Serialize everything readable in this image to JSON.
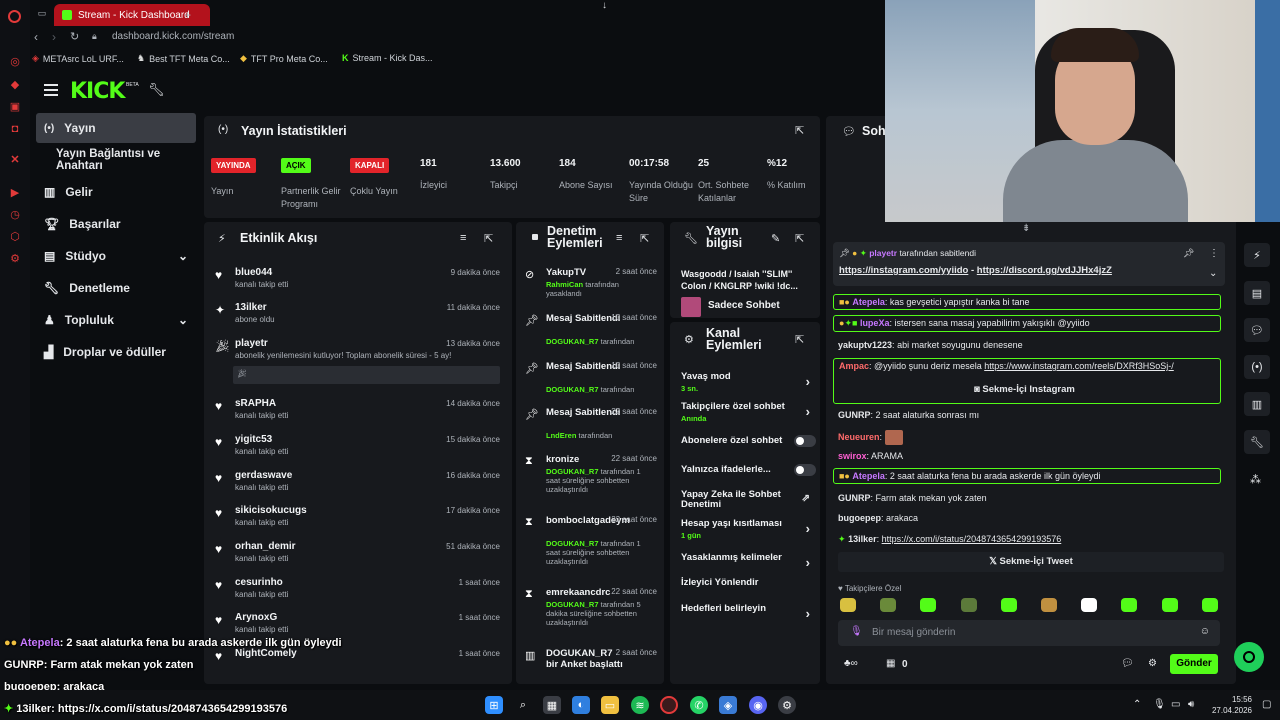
{
  "browser": {
    "tab_title": "Stream - Kick Dashboard",
    "address_domain": "dashboard.kick.com",
    "address_path": "/stream",
    "bookmarks": [
      "METAsrc LoL URF...",
      "Best TFT Meta Co...",
      "TFT Pro Meta Co...",
      "Stream - Kick Das..."
    ]
  },
  "kick": {
    "logo": "KICK",
    "beta": "BETA"
  },
  "sidebar": {
    "items": [
      "Yayın",
      "Yayın Bağlantısı ve Anahtarı",
      "Gelir",
      "Başarılar",
      "Stüdyo",
      "Denetleme",
      "Topluluk",
      "Droplar ve ödüller"
    ]
  },
  "stats": {
    "title": "Yayın İstatistikleri",
    "items": [
      {
        "value": "YAYINDA",
        "label": "Yayın",
        "color": "#e2242a"
      },
      {
        "value": "AÇIK",
        "label": "Partnerlik Gelir Programı",
        "color": "#53fc18"
      },
      {
        "value": "KAPALI",
        "label": "Çoklu Yayın",
        "color": "#e2242a"
      },
      {
        "value": "181",
        "label": "İzleyici"
      },
      {
        "value": "13.600",
        "label": "Takipçi"
      },
      {
        "value": "184",
        "label": "Abone Sayısı"
      },
      {
        "value": "00:17:58",
        "label": "Yayında Olduğu Süre"
      },
      {
        "value": "25",
        "label": "Ort. Sohbete Katılanlar"
      },
      {
        "value": "%12",
        "label": "% Katılım"
      }
    ]
  },
  "activity": {
    "title": "Etkinlik Akışı",
    "rows": [
      {
        "name": "blue044",
        "sub": "kanalı takip etti",
        "time": "9 dakika önce",
        "icon": "heart-icon"
      },
      {
        "name": "13ilker",
        "sub": "abone oldu",
        "time": "11 dakika önce",
        "icon": "sparkle-icon"
      },
      {
        "name": "playetr",
        "sub": "abonelik yenilemesini kutluyor! Toplam abonelik süresi - 5 ay!",
        "time": "13 dakika önce",
        "icon": "party-icon"
      },
      {
        "name": "sRAPHA",
        "sub": "kanalı takip etti",
        "time": "14 dakika önce",
        "icon": "heart-icon"
      },
      {
        "name": "yigitc53",
        "sub": "kanalı takip etti",
        "time": "15 dakika önce",
        "icon": "heart-icon"
      },
      {
        "name": "gerdaswave",
        "sub": "kanalı takip etti",
        "time": "16 dakika önce",
        "icon": "heart-icon"
      },
      {
        "name": "sikicisokucugs",
        "sub": "kanalı takip etti",
        "time": "17 dakika önce",
        "icon": "heart-icon"
      },
      {
        "name": "orhan_demir",
        "sub": "kanalı takip etti",
        "time": "51 dakika önce",
        "icon": "heart-icon"
      },
      {
        "name": "cesurinho",
        "sub": "kanalı takip etti",
        "time": "1 saat önce",
        "icon": "heart-icon"
      },
      {
        "name": "ArynoxG",
        "sub": "kanalı takip etti",
        "time": "1 saat önce",
        "icon": "heart-icon"
      },
      {
        "name": "NightComely",
        "sub": "",
        "time": "1 saat önce",
        "icon": "heart-icon"
      }
    ]
  },
  "moderation": {
    "title": "Denetim Eylemleri",
    "rows": [
      {
        "name": "YakupTV",
        "time": "2 saat önce",
        "mod": "RahmiCan",
        "action": "tarafından yasaklandı",
        "icon": "ban-icon"
      },
      {
        "name": "Mesaj Sabitlendi",
        "time": "10 saat önce",
        "mod": "DOGUKAN_R7",
        "action": "tarafından",
        "icon": "pin-icon"
      },
      {
        "name": "Mesaj Sabitlendi",
        "time": "10 saat önce",
        "mod": "DOGUKAN_R7",
        "action": "tarafından",
        "icon": "pin-icon"
      },
      {
        "name": "Mesaj Sabitlendi",
        "time": "22 saat önce",
        "mod": "LndEren",
        "action": "tarafından",
        "icon": "pin-icon"
      },
      {
        "name": "kronize",
        "time": "22 saat önce",
        "mod": "DOGUKAN_R7",
        "action": "tarafından 1 saat süreliğine sohbetten uzaklaştırıldı",
        "icon": "hourglass-icon"
      },
      {
        "name": "bomboclatgadeym",
        "time": "22 saat önce",
        "mod": "DOGUKAN_R7",
        "action": "tarafından 1 saat süreliğine sohbetten uzaklaştırıldı",
        "icon": "hourglass-icon"
      },
      {
        "name": "emrekaancdrc",
        "time": "22 saat önce",
        "mod": "DOGUKAN_R7",
        "action": "tarafından 5 dakika süreliğine sohbetten uzaklaştırıldı",
        "icon": "hourglass-icon"
      },
      {
        "name": "DOGUKAN_R7 bir Anket başlattı",
        "time": "2 saat önce",
        "mod": "",
        "action": "",
        "icon": "poll-icon"
      }
    ]
  },
  "stream_info": {
    "title": "Yayın bilgisi",
    "stream_title": "Wasgoodd / Isaiah ''SLIM'' Colon / KNGLRP !wiki !dc...",
    "category": "Sadece Sohbet"
  },
  "channel_actions": {
    "title": "Kanal Eylemleri",
    "items": [
      {
        "label": "Yavaş mod",
        "sub": "3 sn.",
        "control": "chevron"
      },
      {
        "label": "Takipçilere özel sohbet",
        "sub": "Anında",
        "control": "chevron"
      },
      {
        "label": "Abonelere özel sohbet",
        "sub": "",
        "control": "toggle"
      },
      {
        "label": "Yalnızca ifadelerle...",
        "sub": "",
        "control": "toggle"
      },
      {
        "label": "Yapay Zeka ile Sohbet Denetimi",
        "sub": "",
        "control": "external"
      },
      {
        "label": "Hesap yaşı kısıtlaması",
        "sub": "1 gün",
        "control": "chevron"
      },
      {
        "label": "Yasaklanmış kelimeler",
        "sub": "",
        "control": "chevron"
      },
      {
        "label": "İzleyici Yönlendir",
        "sub": "",
        "control": "none"
      },
      {
        "label": "Hedefleri belirleyin",
        "sub": "",
        "control": "chevron"
      }
    ]
  },
  "chat": {
    "title": "Sohbet",
    "pinned_by": "playetr",
    "pinned_by_suffix": "tarafından sabitlendi",
    "pinned_link1": "https://instagram.com/yyiido",
    "pinned_sep": " - ",
    "pinned_link2": "https://discord.gg/vdJJHx4jzZ",
    "messages": [
      {
        "user": "Atepela",
        "text": "kas gevşetici yapıştır kanka bi tane",
        "color": "#c678ff"
      },
      {
        "user": "lupeXa",
        "text": "istersen sana masaj yapabilirim yakışıklı @yyiido",
        "color": "#c678ff"
      },
      {
        "user": "yakuptv1223",
        "text": "abi market soyugunu denesene",
        "color": "#e6e8eb"
      },
      {
        "user": "Ampac",
        "text": "@yyiido şunu deriz mesela ",
        "link": "https://www.instagram.com/reels/DXRf3HSoSj-/",
        "color": "#ff6b6b"
      },
      {
        "user": "GUNRP",
        "text": "2 saat alaturka sonrası mı",
        "color": "#e6e8eb"
      },
      {
        "user": "Neueuren",
        "text": "",
        "color": "#ff6b6b"
      },
      {
        "user": "swirox",
        "text": "ARAMA",
        "color": "#ff5fd2"
      },
      {
        "user": "Atepela",
        "text": "2 saat alaturka fena bu arada askerde ilk gün öyleydi",
        "color": "#c678ff"
      },
      {
        "user": "GUNRP",
        "text": "Farm atak mekan yok zaten",
        "color": "#e6e8eb"
      },
      {
        "user": "bugoepep",
        "text": "arakaca",
        "color": "#e6e8eb"
      },
      {
        "user": "13ilker",
        "text": "",
        "link": "https://x.com/i/status/2048743654299193576",
        "color": "#e6e8eb"
      }
    ],
    "instagram_embed": "Sekme-İçi Instagram",
    "tweet_embed": "Sekme-İçi Tweet",
    "followers_only": "Takipçilere Özel",
    "input_placeholder": "Bir mesaj gönderin",
    "count": "0",
    "send": "Gönder"
  },
  "overlay": [
    {
      "user": "Atepela",
      "text": ": 2 saat alaturka fena bu arada askerde ilk gün öyleydi",
      "color": "#c678ff"
    },
    {
      "user": "GUNRP",
      "text": ": Farm atak mekan yok zaten",
      "color": "#ffffff"
    },
    {
      "user": "bugoepep",
      "text": ": arakaca",
      "color": "#ffffff"
    },
    {
      "user": "13ilker",
      "text": ": https://x.com/i/status/2048743654299193576",
      "color": "#ffffff"
    }
  ],
  "taskbar": {
    "time": "15:56",
    "date": "27.04.2026"
  },
  "colors": {
    "accent": "#53fc18",
    "live": "#e2242a",
    "panel": "#17191d"
  }
}
